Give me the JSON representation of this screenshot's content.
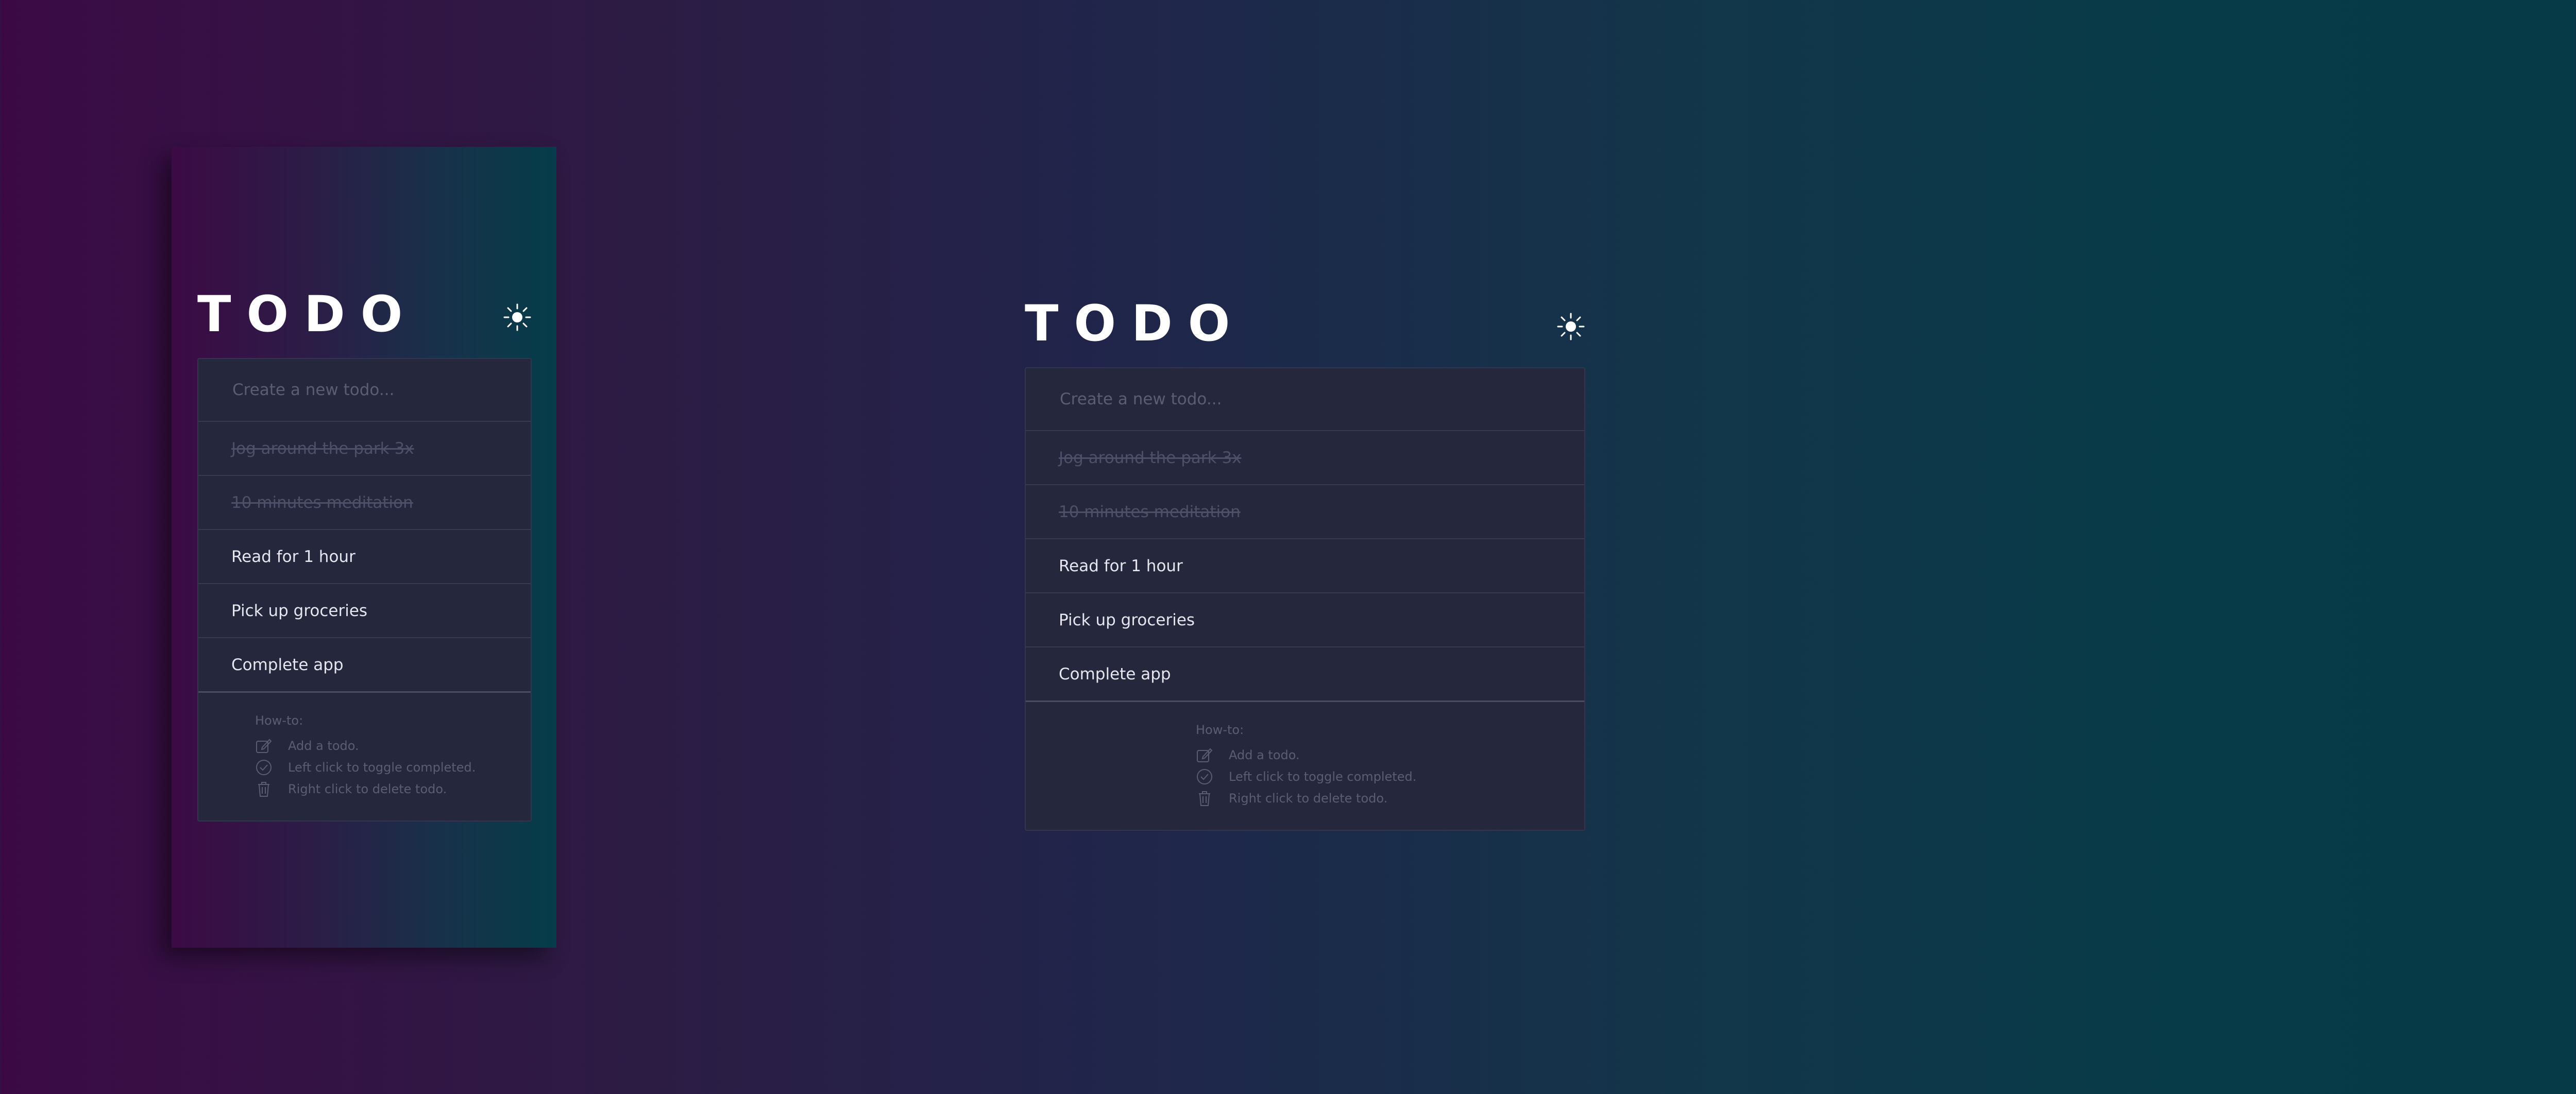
{
  "app": {
    "title": "TODO",
    "theme_toggle_icon": "sun-icon",
    "new_todo_placeholder": "Create a new todo...",
    "todos": [
      {
        "text": "Jog around the park 3x",
        "completed": true
      },
      {
        "text": "10 minutes meditation",
        "completed": true
      },
      {
        "text": "Read for 1 hour",
        "completed": false
      },
      {
        "text": "Pick up groceries",
        "completed": false
      },
      {
        "text": "Complete app",
        "completed": false
      }
    ],
    "howto": {
      "heading": "How-to:",
      "items": [
        {
          "icon": "edit-icon",
          "text": "Add a todo."
        },
        {
          "icon": "check-circle-icon",
          "text": "Left click to toggle completed."
        },
        {
          "icon": "trash-icon",
          "text": "Right click to delete todo."
        }
      ]
    }
  },
  "colors": {
    "card_background": "#25273c",
    "text_primary": "#e6e6f0",
    "text_muted": "#5b5d74",
    "completed_text": "#4d5068"
  }
}
